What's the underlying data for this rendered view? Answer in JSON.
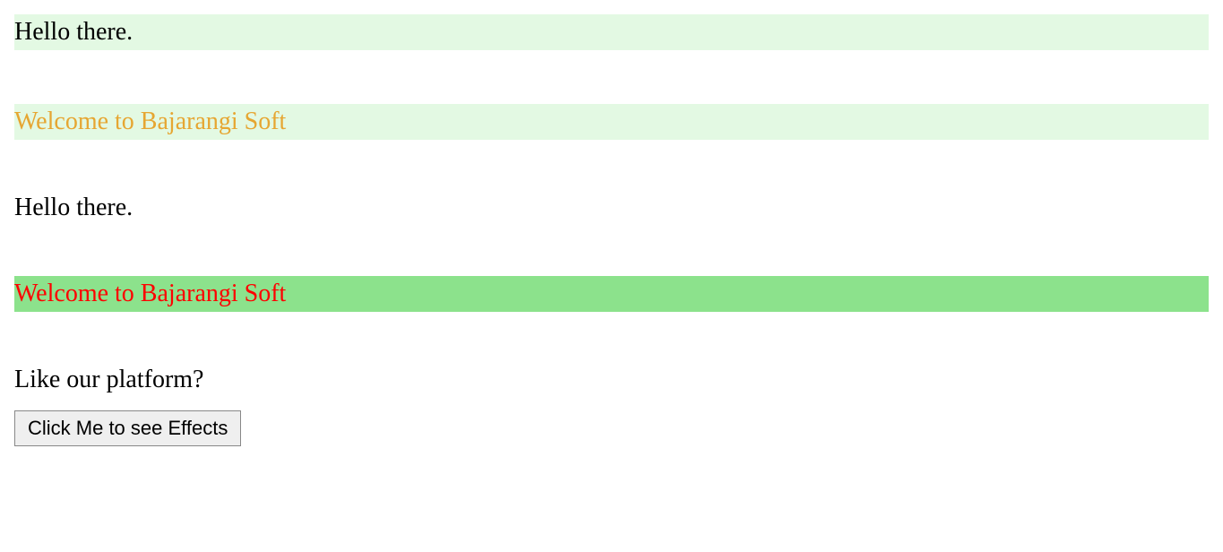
{
  "line1": "Hello there.",
  "line2": "Welcome to Bajarangi Soft",
  "line3": "Hello there.",
  "line4": "Welcome to Bajarangi Soft",
  "line5": "Like our platform?",
  "button_label": "Click Me to see Effects",
  "colors": {
    "light_green": "#e3f9e3",
    "bright_green": "#8ce28c",
    "orange": "#e6a632",
    "red": "#ff0000"
  }
}
